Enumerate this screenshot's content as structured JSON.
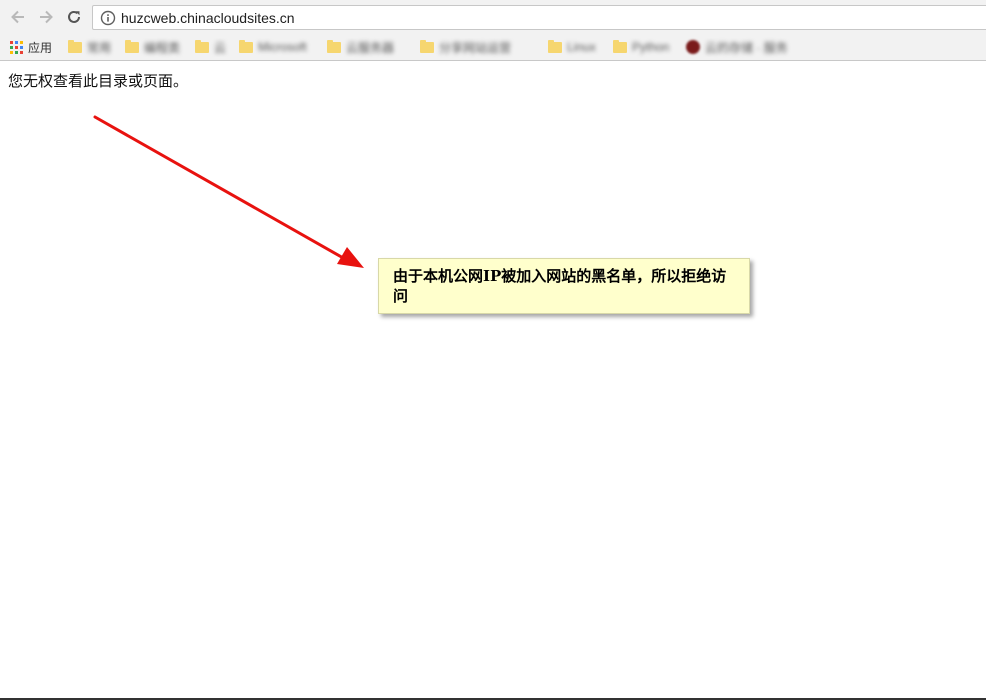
{
  "browser": {
    "url": "huzcweb.chinacloudsites.cn",
    "bookmarks": [
      {
        "label": "应用",
        "type": "apps"
      },
      {
        "label": "常用",
        "type": "folder"
      },
      {
        "label": "编程类",
        "type": "folder"
      },
      {
        "label": "云",
        "type": "folder"
      },
      {
        "label": "Microsoft",
        "type": "folder"
      },
      {
        "label": "云服务器",
        "type": "folder"
      },
      {
        "label": "分享网站运营",
        "type": "folder"
      },
      {
        "label": "Linux",
        "type": "folder"
      },
      {
        "label": "Python",
        "type": "folder"
      },
      {
        "label": "云的存储 · 服务",
        "type": "site"
      }
    ],
    "icons": {
      "back": "arrow-left-icon",
      "forward": "arrow-right-icon",
      "reload": "reload-icon",
      "info": "info-icon"
    }
  },
  "page": {
    "message": "您无权查看此目录或页面。"
  },
  "annotation": {
    "text": "由于本机公网IP被加入网站的黑名单，所以拒绝访问",
    "arrow_color": "#e8120f",
    "note_bg": "#ffffcc"
  },
  "colors": {
    "folder": "#f6d66f",
    "apps_grid": [
      "#e94235",
      "#4285f4",
      "#fbbc05",
      "#34a853",
      "#e94235",
      "#4285f4",
      "#fbbc05",
      "#34a853",
      "#e94235"
    ]
  }
}
